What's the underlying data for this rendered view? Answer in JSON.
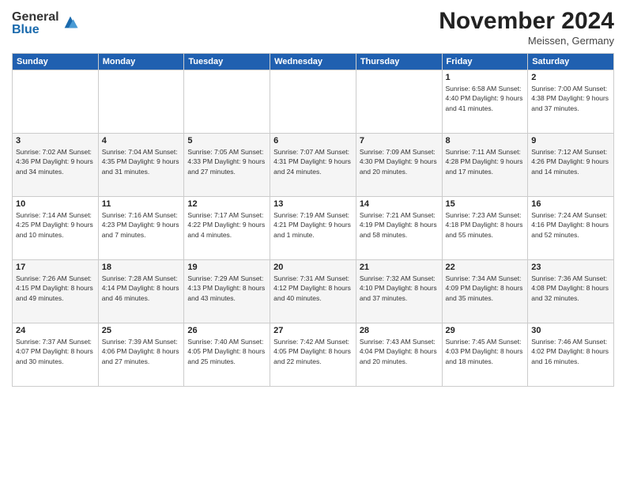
{
  "logo": {
    "general": "General",
    "blue": "Blue"
  },
  "header": {
    "month": "November 2024",
    "location": "Meissen, Germany"
  },
  "weekdays": [
    "Sunday",
    "Monday",
    "Tuesday",
    "Wednesday",
    "Thursday",
    "Friday",
    "Saturday"
  ],
  "weeks": [
    [
      {
        "day": "",
        "info": ""
      },
      {
        "day": "",
        "info": ""
      },
      {
        "day": "",
        "info": ""
      },
      {
        "day": "",
        "info": ""
      },
      {
        "day": "",
        "info": ""
      },
      {
        "day": "1",
        "info": "Sunrise: 6:58 AM\nSunset: 4:40 PM\nDaylight: 9 hours and 41 minutes."
      },
      {
        "day": "2",
        "info": "Sunrise: 7:00 AM\nSunset: 4:38 PM\nDaylight: 9 hours and 37 minutes."
      }
    ],
    [
      {
        "day": "3",
        "info": "Sunrise: 7:02 AM\nSunset: 4:36 PM\nDaylight: 9 hours and 34 minutes."
      },
      {
        "day": "4",
        "info": "Sunrise: 7:04 AM\nSunset: 4:35 PM\nDaylight: 9 hours and 31 minutes."
      },
      {
        "day": "5",
        "info": "Sunrise: 7:05 AM\nSunset: 4:33 PM\nDaylight: 9 hours and 27 minutes."
      },
      {
        "day": "6",
        "info": "Sunrise: 7:07 AM\nSunset: 4:31 PM\nDaylight: 9 hours and 24 minutes."
      },
      {
        "day": "7",
        "info": "Sunrise: 7:09 AM\nSunset: 4:30 PM\nDaylight: 9 hours and 20 minutes."
      },
      {
        "day": "8",
        "info": "Sunrise: 7:11 AM\nSunset: 4:28 PM\nDaylight: 9 hours and 17 minutes."
      },
      {
        "day": "9",
        "info": "Sunrise: 7:12 AM\nSunset: 4:26 PM\nDaylight: 9 hours and 14 minutes."
      }
    ],
    [
      {
        "day": "10",
        "info": "Sunrise: 7:14 AM\nSunset: 4:25 PM\nDaylight: 9 hours and 10 minutes."
      },
      {
        "day": "11",
        "info": "Sunrise: 7:16 AM\nSunset: 4:23 PM\nDaylight: 9 hours and 7 minutes."
      },
      {
        "day": "12",
        "info": "Sunrise: 7:17 AM\nSunset: 4:22 PM\nDaylight: 9 hours and 4 minutes."
      },
      {
        "day": "13",
        "info": "Sunrise: 7:19 AM\nSunset: 4:21 PM\nDaylight: 9 hours and 1 minute."
      },
      {
        "day": "14",
        "info": "Sunrise: 7:21 AM\nSunset: 4:19 PM\nDaylight: 8 hours and 58 minutes."
      },
      {
        "day": "15",
        "info": "Sunrise: 7:23 AM\nSunset: 4:18 PM\nDaylight: 8 hours and 55 minutes."
      },
      {
        "day": "16",
        "info": "Sunrise: 7:24 AM\nSunset: 4:16 PM\nDaylight: 8 hours and 52 minutes."
      }
    ],
    [
      {
        "day": "17",
        "info": "Sunrise: 7:26 AM\nSunset: 4:15 PM\nDaylight: 8 hours and 49 minutes."
      },
      {
        "day": "18",
        "info": "Sunrise: 7:28 AM\nSunset: 4:14 PM\nDaylight: 8 hours and 46 minutes."
      },
      {
        "day": "19",
        "info": "Sunrise: 7:29 AM\nSunset: 4:13 PM\nDaylight: 8 hours and 43 minutes."
      },
      {
        "day": "20",
        "info": "Sunrise: 7:31 AM\nSunset: 4:12 PM\nDaylight: 8 hours and 40 minutes."
      },
      {
        "day": "21",
        "info": "Sunrise: 7:32 AM\nSunset: 4:10 PM\nDaylight: 8 hours and 37 minutes."
      },
      {
        "day": "22",
        "info": "Sunrise: 7:34 AM\nSunset: 4:09 PM\nDaylight: 8 hours and 35 minutes."
      },
      {
        "day": "23",
        "info": "Sunrise: 7:36 AM\nSunset: 4:08 PM\nDaylight: 8 hours and 32 minutes."
      }
    ],
    [
      {
        "day": "24",
        "info": "Sunrise: 7:37 AM\nSunset: 4:07 PM\nDaylight: 8 hours and 30 minutes."
      },
      {
        "day": "25",
        "info": "Sunrise: 7:39 AM\nSunset: 4:06 PM\nDaylight: 8 hours and 27 minutes."
      },
      {
        "day": "26",
        "info": "Sunrise: 7:40 AM\nSunset: 4:05 PM\nDaylight: 8 hours and 25 minutes."
      },
      {
        "day": "27",
        "info": "Sunrise: 7:42 AM\nSunset: 4:05 PM\nDaylight: 8 hours and 22 minutes."
      },
      {
        "day": "28",
        "info": "Sunrise: 7:43 AM\nSunset: 4:04 PM\nDaylight: 8 hours and 20 minutes."
      },
      {
        "day": "29",
        "info": "Sunrise: 7:45 AM\nSunset: 4:03 PM\nDaylight: 8 hours and 18 minutes."
      },
      {
        "day": "30",
        "info": "Sunrise: 7:46 AM\nSunset: 4:02 PM\nDaylight: 8 hours and 16 minutes."
      }
    ]
  ]
}
